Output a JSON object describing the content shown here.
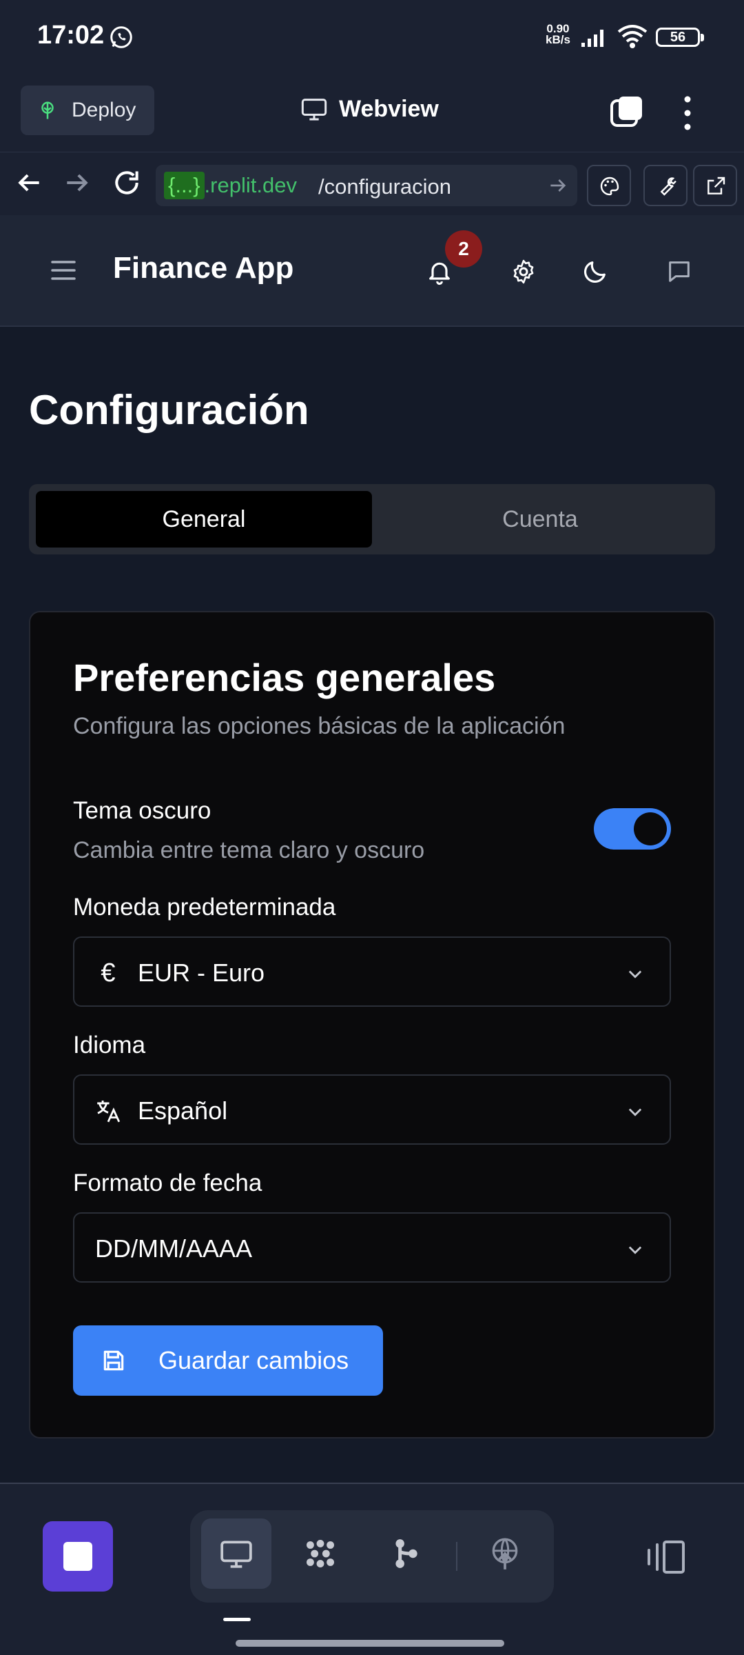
{
  "status_bar": {
    "time": "17:02",
    "net_speed_value": "0.90",
    "net_speed_unit": "kB/s",
    "battery": "56"
  },
  "replit_bar": {
    "deploy_label": "Deploy",
    "title": "Webview"
  },
  "url_bar": {
    "host_brace": "{...}",
    "host_domain": ".replit.dev",
    "path": "/configuracion"
  },
  "app_header": {
    "title": "Finance App",
    "notification_count": "2"
  },
  "page": {
    "title": "Configuración",
    "tabs": [
      {
        "label": "General",
        "active": true
      },
      {
        "label": "Cuenta",
        "active": false
      }
    ]
  },
  "card": {
    "title": "Preferencias generales",
    "subtitle": "Configura las opciones básicas de la aplicación",
    "dark_theme": {
      "label": "Tema oscuro",
      "description": "Cambia entre tema claro y oscuro",
      "enabled": true
    },
    "currency": {
      "label": "Moneda predeterminada",
      "icon": "€",
      "value": "EUR - Euro"
    },
    "language": {
      "label": "Idioma",
      "value": "Español"
    },
    "date_format": {
      "label": "Formato de fecha",
      "value": "DD/MM/AAAA"
    },
    "save_label": "Guardar cambios"
  },
  "colors": {
    "accent": "#3b82f6",
    "badge": "#8b1d1d",
    "home_button": "#5b3fd6"
  }
}
